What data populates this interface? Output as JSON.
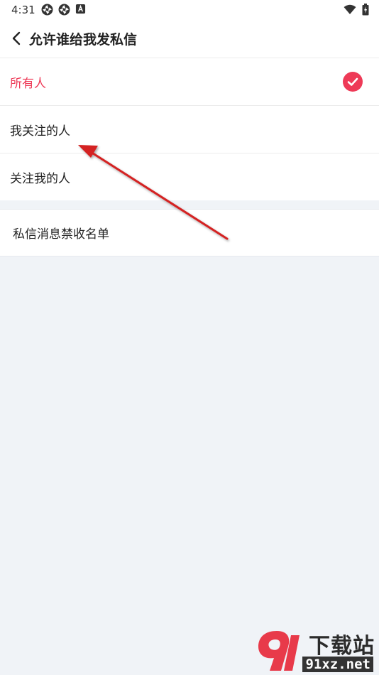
{
  "status_bar": {
    "time": "4:31"
  },
  "app_bar": {
    "title": "允许谁给我发私信"
  },
  "options": [
    {
      "label": "所有人",
      "selected": true
    },
    {
      "label": "我关注的人",
      "selected": false
    },
    {
      "label": "关注我的人",
      "selected": false
    }
  ],
  "blocklist": {
    "label": "私信消息禁收名单"
  },
  "watermark": {
    "brand": "下载站",
    "domain": "91xz.net"
  },
  "colors": {
    "accent": "#ee3a57",
    "background": "#f0f3f7",
    "annotation": "#d42020"
  }
}
